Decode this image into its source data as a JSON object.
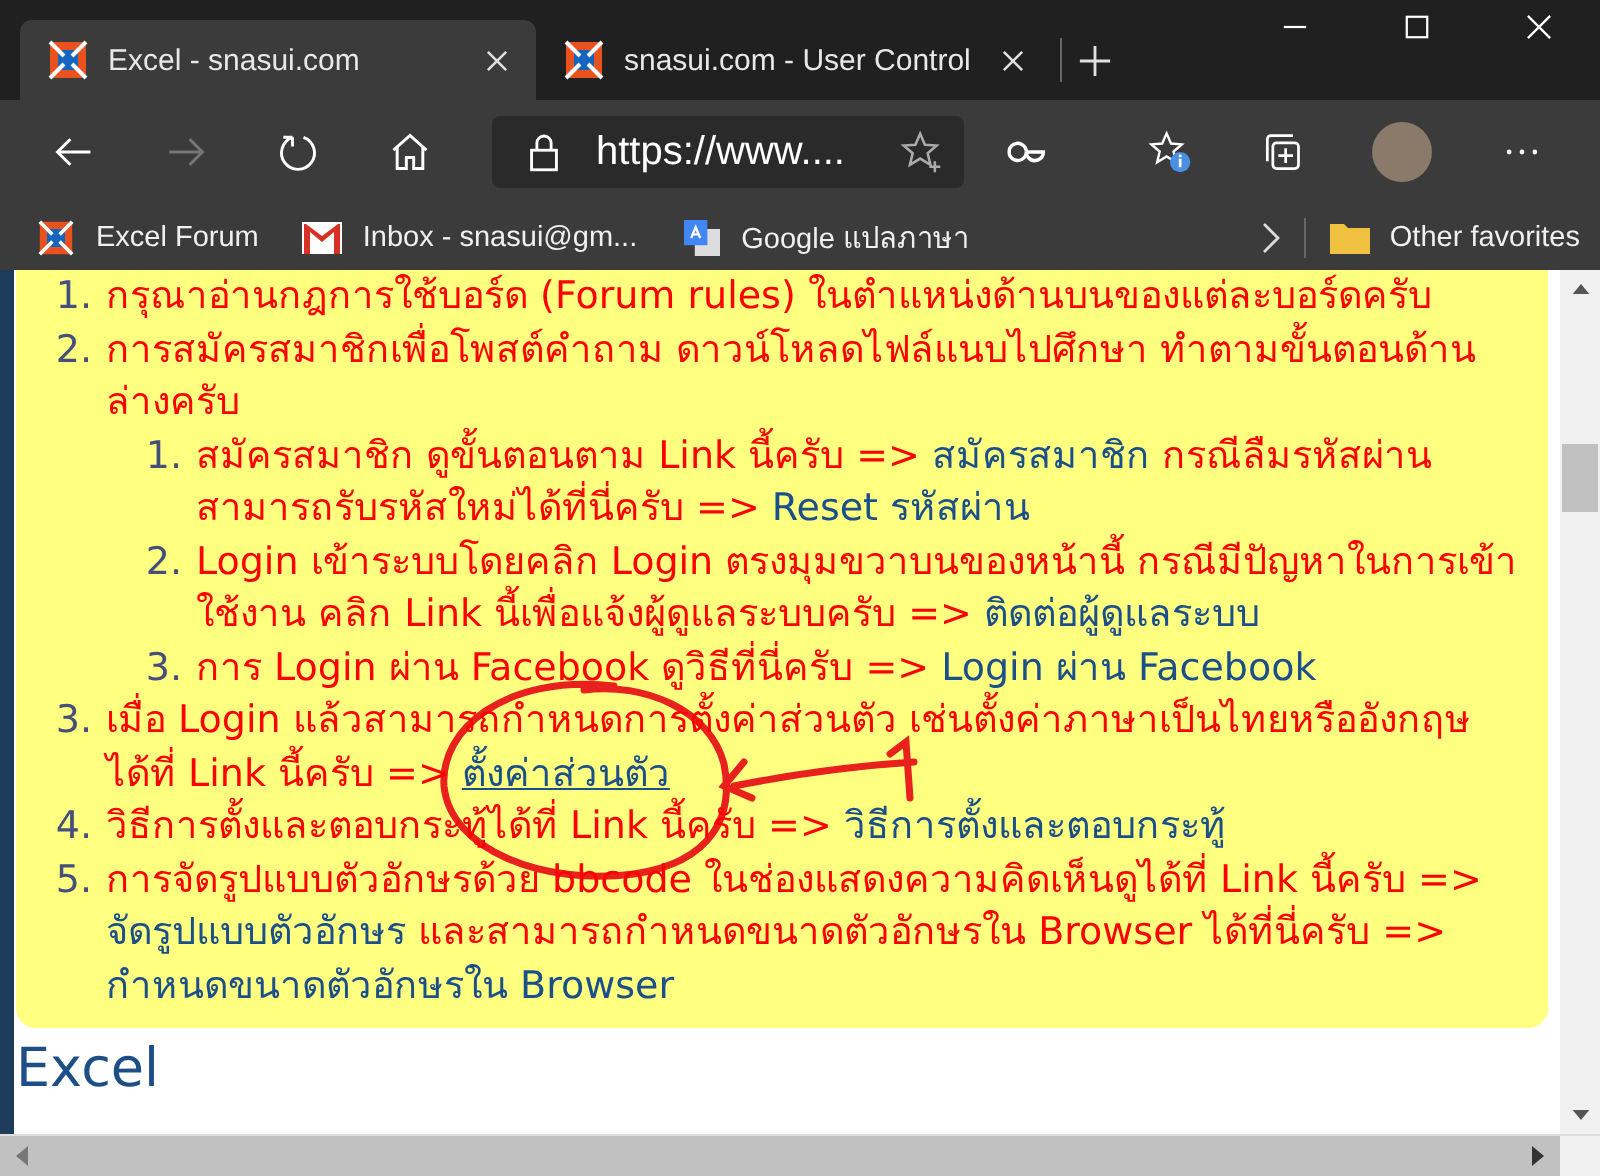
{
  "tabs": [
    {
      "title": "Excel - snasui.com",
      "selected": true
    },
    {
      "title": "snasui.com - User Control",
      "selected": false
    }
  ],
  "address_bar": {
    "url": "https://www...."
  },
  "bookmarks": [
    {
      "kind": "site",
      "label": "Excel Forum"
    },
    {
      "kind": "mail",
      "label": "Inbox - snasui@gm..."
    },
    {
      "kind": "translate",
      "label": "Google แปลภาษา"
    }
  ],
  "other_favorites": "Other favorites",
  "notice": {
    "items": [
      {
        "number": "1.",
        "segments": [
          {
            "kind": "text",
            "text": "กรุณาอ่านกฎการใช้บอร์ด (Forum rules) ในตำแหน่งด้านบนของแต่ละบอร์ดครับ"
          }
        ]
      },
      {
        "number": "2.",
        "segments": [
          {
            "kind": "text",
            "text": "การสมัครสมาชิกเพื่อโพสต์คำถาม ดาวน์โหลดไฟล์แนบไปศึกษา ทำตามขั้นตอนด้านล่างครับ"
          }
        ],
        "children": [
          {
            "number": "1.",
            "segments": [
              {
                "kind": "text",
                "text": "สมัครสมาชิก ดูขั้นตอนตาม Link นี้ครับ => "
              },
              {
                "kind": "link",
                "text": "สมัครสมาชิก"
              },
              {
                "kind": "text",
                "text": " กรณีลืมรหัสผ่านสามารถรับรหัสใหม่ได้ที่นี่ครับ => "
              },
              {
                "kind": "link",
                "text": "Reset รหัสผ่าน"
              }
            ]
          },
          {
            "number": "2.",
            "segments": [
              {
                "kind": "text",
                "text": "Login เข้าระบบโดยคลิก Login ตรงมุมขวาบนของหน้านี้ กรณีมีปัญหาในการเข้าใช้งาน คลิก Link นี้เพื่อแจ้งผู้ดูแลระบบครับ => "
              },
              {
                "kind": "link",
                "text": "ติดต่อผู้ดูแลระบบ"
              }
            ]
          },
          {
            "number": "3.",
            "segments": [
              {
                "kind": "text",
                "text": "การ Login ผ่าน Facebook ดูวิธีที่นี่ครับ => "
              },
              {
                "kind": "link",
                "text": "Login ผ่าน Facebook"
              }
            ]
          }
        ]
      },
      {
        "number": "3.",
        "segments": [
          {
            "kind": "text",
            "text": "เมื่อ Login แล้วสามารถกำหนดการตั้งค่าส่วนตัว เช่นตั้งค่าภาษาเป็นไทยหรืออังกฤษได้ที่ Link นี้ครับ => "
          },
          {
            "kind": "underlined-link",
            "text": "ตั้งค่าส่วนตัว"
          }
        ]
      },
      {
        "number": "4.",
        "segments": [
          {
            "kind": "text",
            "text": "วิธีการตั้งและตอบกระทู้ได้ที่ Link นี้ครับ => "
          },
          {
            "kind": "link",
            "text": "วิธีการตั้งและตอบกระทู้"
          }
        ]
      },
      {
        "number": "5.",
        "segments": [
          {
            "kind": "text",
            "text": "การจัดรูปแบบตัวอักษรด้วย bbcode ในช่องแสดงความคิดเห็นดูได้ที่ Link นี้ครับ => "
          },
          {
            "kind": "link",
            "text": "จัดรูปแบบตัวอักษร"
          },
          {
            "kind": "text",
            "text": " และสามารถกำหนดขนาดตัวอักษรใน Browser ได้ที่นี่ครับ => "
          },
          {
            "kind": "link",
            "text": "กำหนดขนาดตัวอักษรใน Browser"
          }
        ]
      }
    ]
  },
  "heading": "Excel"
}
